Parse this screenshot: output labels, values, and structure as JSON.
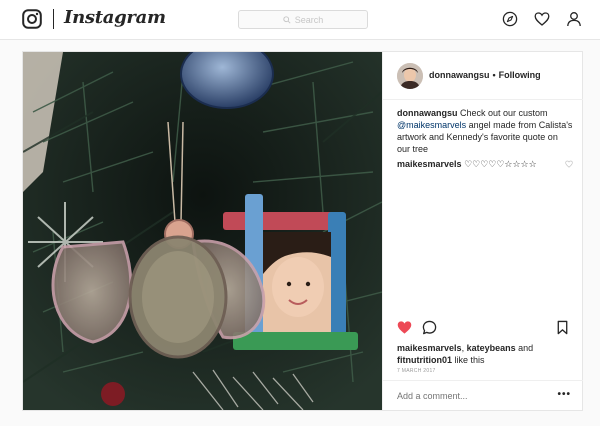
{
  "header": {
    "wordmark": "Instagram",
    "search_placeholder": "Search",
    "icons": [
      "camera-logo-icon",
      "compass-icon",
      "heart-icon",
      "profile-icon"
    ]
  },
  "post": {
    "author": "donnawangsu",
    "separator": "•",
    "follow_status": "Following",
    "caption": {
      "username": "donnawangsu",
      "text_before": " Check out our custom ",
      "mention": "@maikesmarvels",
      "text_after": " angel made from Calista's artwork and Kennedy's favorite quote on our tree"
    },
    "comments": [
      {
        "username": "maikesmarvels",
        "text": " ♡♡♡♡♡☆☆☆☆"
      }
    ],
    "likes": {
      "user1": "maikesmarvels",
      "sep1": ", ",
      "user2": "kateybeans",
      "sep2": " and",
      "user3": "fitnutrition01",
      "suffix": " like this"
    },
    "timestamp": "7 MARCH 2017",
    "add_comment_placeholder": "Add a comment...",
    "more_label": "•••"
  },
  "colors": {
    "like_red": "#ed4956",
    "mention_blue": "#003569",
    "border": "#e6e6e6"
  }
}
